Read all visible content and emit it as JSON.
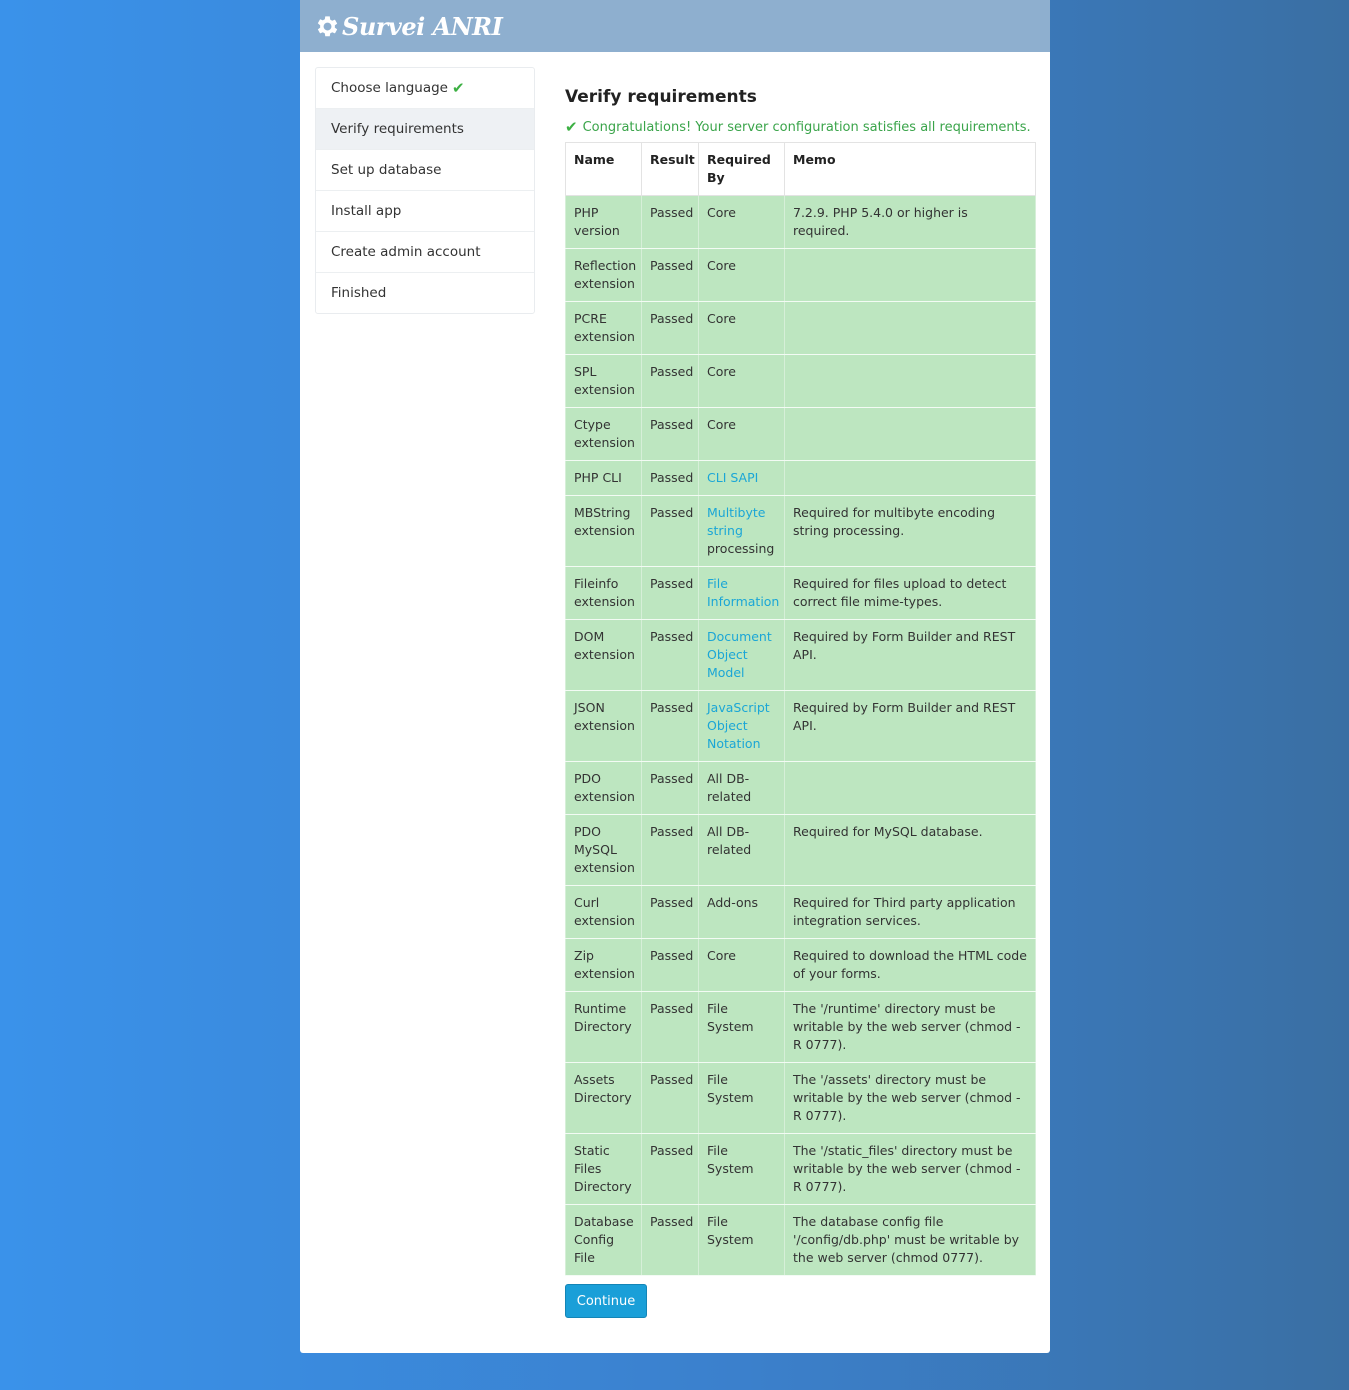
{
  "app": {
    "title": "Survei ANRI"
  },
  "sidebar": {
    "items": [
      {
        "label": "Choose language",
        "done": true
      },
      {
        "label": "Verify requirements",
        "active": true
      },
      {
        "label": "Set up database"
      },
      {
        "label": "Install app"
      },
      {
        "label": "Create admin account"
      },
      {
        "label": "Finished"
      }
    ]
  },
  "main": {
    "title": "Verify requirements",
    "success_message": "Congratulations! Your server configuration satisfies all requirements.",
    "continue_label": "Continue"
  },
  "table": {
    "headers": [
      "Name",
      "Result",
      "Required By",
      "Memo"
    ],
    "rows": [
      {
        "name": "PHP version",
        "result": "Passed",
        "by": "Core",
        "memo": "7.2.9. PHP 5.4.0 or higher is required."
      },
      {
        "name": "Reflection extension",
        "result": "Passed",
        "by": "Core",
        "memo": ""
      },
      {
        "name": "PCRE extension",
        "result": "Passed",
        "by": "Core",
        "memo": ""
      },
      {
        "name": "SPL extension",
        "result": "Passed",
        "by": "Core",
        "memo": ""
      },
      {
        "name": "Ctype extension",
        "result": "Passed",
        "by": "Core",
        "memo": ""
      },
      {
        "name": "PHP CLI",
        "result": "Passed",
        "by_link": "CLI SAPI",
        "memo": ""
      },
      {
        "name": "MBString extension",
        "result": "Passed",
        "by_link": "Multibyte string",
        "by": "processing",
        "memo": "Required for multibyte encoding string processing."
      },
      {
        "name": "Fileinfo extension",
        "result": "Passed",
        "by_link": "File Information",
        "memo": "Required for files upload to detect correct file mime-types."
      },
      {
        "name": "DOM extension",
        "result": "Passed",
        "by_link": "Document Object Model",
        "memo": "Required by Form Builder and REST API."
      },
      {
        "name": "JSON extension",
        "result": "Passed",
        "by_link": "JavaScript Object Notation",
        "memo": "Required by Form Builder and REST API."
      },
      {
        "name": "PDO extension",
        "result": "Passed",
        "by": "All DB-related",
        "memo": ""
      },
      {
        "name": "PDO MySQL extension",
        "result": "Passed",
        "by": "All DB-related",
        "memo": "Required for MySQL database."
      },
      {
        "name": "Curl extension",
        "result": "Passed",
        "by": "Add-ons",
        "memo": "Required for Third party application integration services."
      },
      {
        "name": "Zip extension",
        "result": "Passed",
        "by": "Core",
        "memo": "Required to download the HTML code of your forms."
      },
      {
        "name": "Runtime Directory",
        "result": "Passed",
        "by": "File System",
        "memo": "The '/runtime' directory must be writable by the web server (chmod -R 0777)."
      },
      {
        "name": "Assets Directory",
        "result": "Passed",
        "by": "File System",
        "memo": "The '/assets' directory must be writable by the web server (chmod -R 0777)."
      },
      {
        "name": "Static Files Directory",
        "result": "Passed",
        "by": "File System",
        "memo": "The '/static_files' directory must be writable by the web server (chmod -R 0777)."
      },
      {
        "name": "Database Config File",
        "result": "Passed",
        "by": "File System",
        "memo": "The database config file '/config/db.php' must be writable by the web server (chmod 0777)."
      }
    ]
  },
  "colors": {
    "success": "#3aa44a",
    "row_bg": "#bde6c0",
    "link": "#1ba6d6",
    "button": "#1a9fd8",
    "header_bg": "#8eafcf"
  },
  "icons": {
    "logo": "gear-icon",
    "done": "check-icon"
  }
}
